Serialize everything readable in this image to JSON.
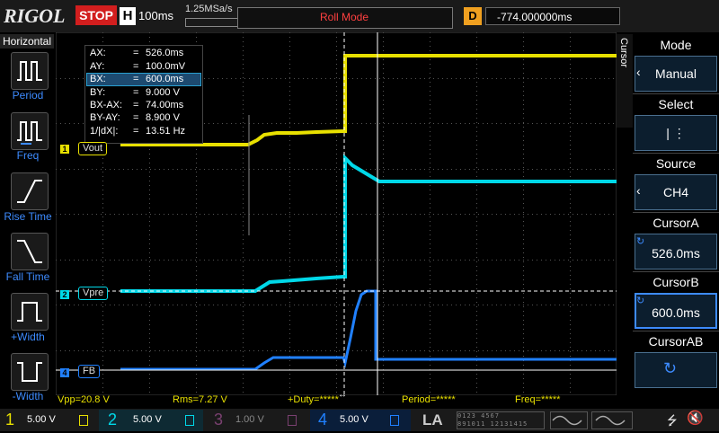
{
  "colors": {
    "ch1": "#e8e000",
    "ch2": "#00d8e8",
    "ch3": "#e040e0",
    "ch4": "#2080ff",
    "accent": "#3d8bff",
    "stop": "#d21e1e",
    "delay": "#f0a020"
  },
  "header": {
    "logo": "RIGOL",
    "run_state": "STOP",
    "timebase_label": "H",
    "timebase_value": "100ms",
    "sample_rate": "1.25MSa/s",
    "mode": "Roll Mode",
    "delay_label": "D",
    "delay_value": "-774.000000ms"
  },
  "left_panel": {
    "title": "Horizontal",
    "items": [
      {
        "label": "Period",
        "icon": "period-icon"
      },
      {
        "label": "Freq",
        "icon": "frequency-icon"
      },
      {
        "label": "Rise Time",
        "icon": "rise-time-icon"
      },
      {
        "label": "Fall Time",
        "icon": "fall-time-icon"
      },
      {
        "label": "+Width",
        "icon": "positive-width-icon"
      },
      {
        "label": "-Width",
        "icon": "negative-width-icon"
      }
    ]
  },
  "cursor_readout": [
    {
      "name": "AX:",
      "value": "526.0ms"
    },
    {
      "name": "AY:",
      "value": "100.0mV"
    },
    {
      "name": "BX:",
      "value": "600.0ms"
    },
    {
      "name": "BY:",
      "value": "9.000 V"
    },
    {
      "name": "BX-AX:",
      "value": "74.00ms"
    },
    {
      "name": "BY-AY:",
      "value": "8.900 V"
    },
    {
      "name": "1/|dX|:",
      "value": "13.51 Hz"
    }
  ],
  "channel_tags": {
    "ch1": {
      "num": "1",
      "label": "Vout"
    },
    "ch2": {
      "num": "2",
      "label": "Vpre"
    },
    "ch4": {
      "num": "4",
      "label": "FB"
    }
  },
  "bottom_measurements": [
    {
      "text": "Vpp=20.8 V"
    },
    {
      "text": "Rms=7.27 V"
    },
    {
      "text": "+Duty=*****"
    },
    {
      "text": "Period=*****"
    },
    {
      "text": "Freq=*****"
    }
  ],
  "channels": [
    {
      "num": "1",
      "scale": "5.00 V"
    },
    {
      "num": "2",
      "scale": "5.00 V"
    },
    {
      "num": "3",
      "scale": "1.00 V"
    },
    {
      "num": "4",
      "scale": "5.00 V"
    }
  ],
  "la_label": "LA",
  "digital_channels": [
    "0",
    "1",
    "2",
    "3",
    "4",
    "5",
    "6",
    "7",
    "8",
    "9",
    "10",
    "11",
    "12",
    "13",
    "14",
    "15"
  ],
  "right_panel": {
    "side_label": "Cursor",
    "mode_title": "Mode",
    "mode_value": "Manual",
    "select_title": "Select",
    "select_value": "|  ⋮",
    "source_title": "Source",
    "source_value": "CH4",
    "cursorA_title": "CursorA",
    "cursorA_value": "526.0ms",
    "cursorB_title": "CursorB",
    "cursorB_value": "600.0ms",
    "cursorAB_title": "CursorAB"
  }
}
